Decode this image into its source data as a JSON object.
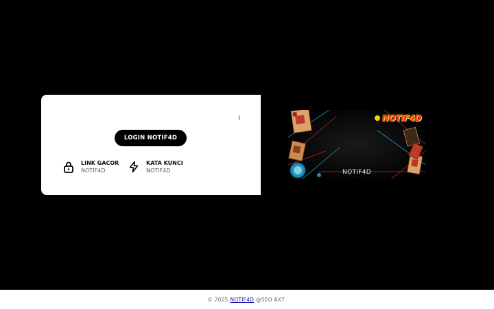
{
  "login_card": {
    "login_button_label": "LOGIN NOTIF4D",
    "features": [
      {
        "icon": "lock-icon",
        "title": "LINK GACOR",
        "subtitle": "NOTIF4D"
      },
      {
        "icon": "lightning-icon",
        "title": "KATA KUNCI",
        "subtitle": "NOTIF4D"
      }
    ]
  },
  "banner": {
    "logo_text": "NOTIF4D",
    "caption": "NOTIF4D"
  },
  "footer": {
    "prefix": "© 2025",
    "link_text": "NOTIF4D",
    "suffix": "@SEO AX7."
  },
  "colors": {
    "page_background": "#000000",
    "card_background": "#ffffff",
    "button_background": "#000000",
    "logo_red": "#ff3a2a"
  }
}
